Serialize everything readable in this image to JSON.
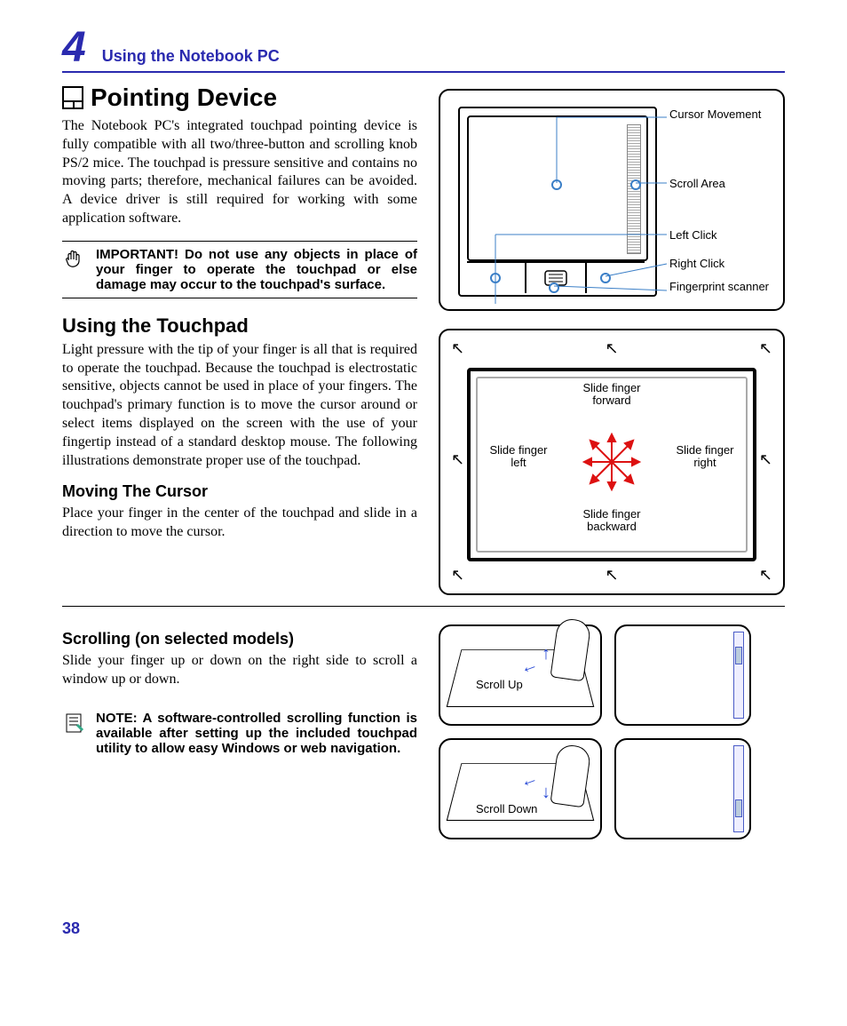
{
  "chapter": {
    "number": "4",
    "title": "Using the Notebook PC"
  },
  "page_number": "38",
  "section": {
    "h1": "Pointing Device",
    "intro": "The Notebook PC's integrated touchpad pointing device is fully compatible with all two/three-button and scrolling knob PS/2 mice. The touchpad is pressure sensitive and contains no moving parts; therefore, mechanical failures can be avoided. A device driver is still required for working with some application software.",
    "important": "IMPORTANT! Do not use any objects in place of your finger to operate the touchpad or else damage may occur to the touchpad's surface.",
    "h2": "Using the Touchpad",
    "touchpad_body": "Light pressure with the tip of your finger is all that is required to operate the touchpad. Because the touchpad is electrostatic sensitive, objects cannot be used in place of your fingers. The touchpad's primary function is to move the cursor around or select items displayed on the screen with the use of your fingertip instead of a standard desktop mouse. The following illustrations demonstrate proper use of the touchpad.",
    "h3_cursor": "Moving The Cursor",
    "cursor_body": "Place your finger in the center of the touchpad and slide in a direction to move the cursor.",
    "h3_scroll": "Scrolling (on selected models)",
    "scroll_body": "Slide your finger up or down on the right side to scroll a window up or down.",
    "note": "NOTE: A software-controlled scrolling function is available after setting up the included touchpad utility to allow easy Windows or web navigation."
  },
  "diagram1": {
    "cursor_movement": "Cursor Movement",
    "scroll_area": "Scroll Area",
    "left_click": "Left Click",
    "right_click": "Right Click",
    "fingerprint": "Fingerprint scanner"
  },
  "diagram2": {
    "forward": "Slide finger forward",
    "backward": "Slide finger backward",
    "left": "Slide finger left",
    "right": "Slide finger right"
  },
  "diagram3": {
    "up": "Scroll Up",
    "down": "Scroll Down"
  }
}
